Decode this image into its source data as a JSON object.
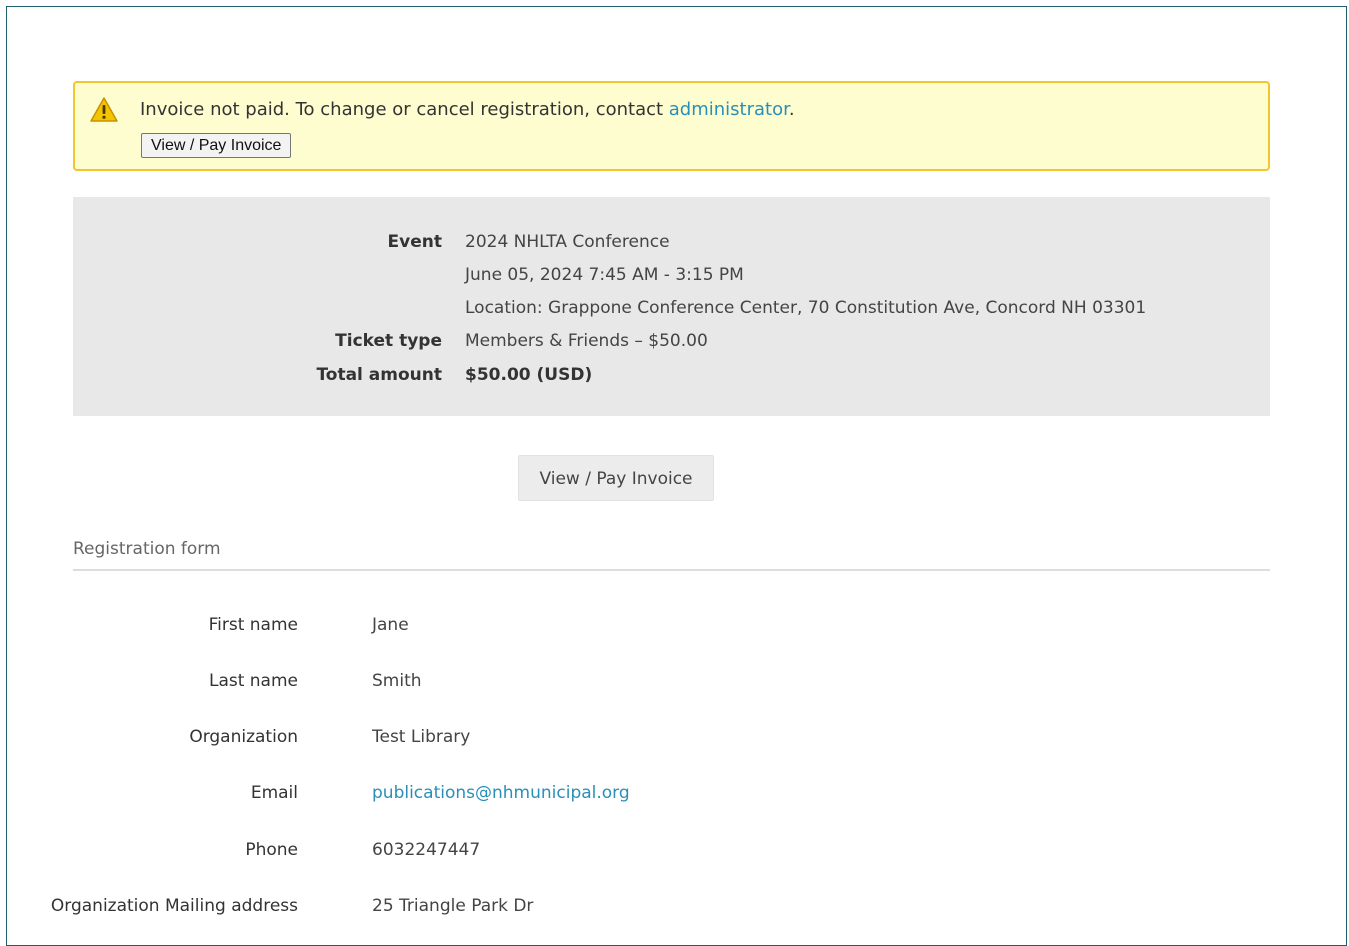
{
  "alert": {
    "message": "Invoice not paid. To change or cancel registration, contact ",
    "link_text": "administrator",
    "message_end": ".",
    "button_label": "View / Pay Invoice",
    "icon": "warning-icon",
    "colors": {
      "background": "#fefdd0",
      "border": "#f3c630",
      "link": "#2a8fb8"
    }
  },
  "summary": {
    "event_label": "Event",
    "event_name": "2024 NHLTA Conference",
    "event_date": "June 05, 2024 7:45 AM - 3:15 PM",
    "event_location": "Location: Grappone Conference Center, 70 Constitution Ave, Concord NH 03301",
    "ticket_label": "Ticket type",
    "ticket_value": "Members & Friends – $50.00",
    "total_label": "Total amount",
    "total_value": "$50.00 (USD)"
  },
  "main_button_label": "View / Pay Invoice",
  "form": {
    "title": "Registration form",
    "fields": [
      {
        "label": "First name",
        "value": "Jane"
      },
      {
        "label": "Last name",
        "value": "Smith"
      },
      {
        "label": "Organization",
        "value": "Test Library"
      },
      {
        "label": "Email",
        "value": "publications@nhmunicipal.org"
      },
      {
        "label": "Phone",
        "value": "6032247447"
      },
      {
        "label": "Organization Mailing address",
        "value": "25 Triangle Park Dr"
      }
    ]
  }
}
